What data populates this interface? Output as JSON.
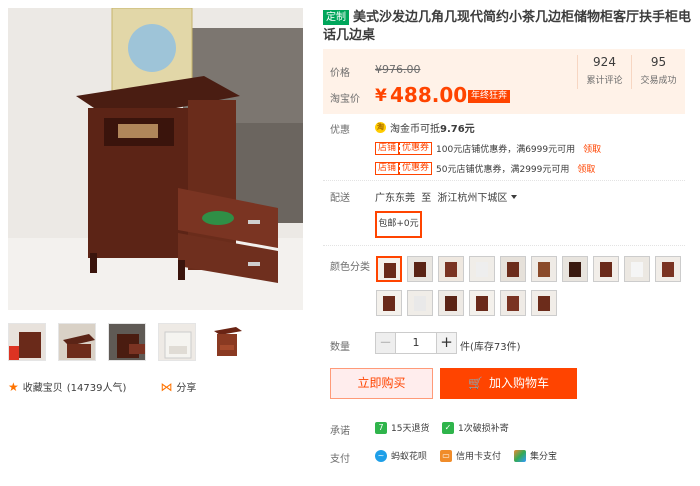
{
  "product": {
    "badge": "定制",
    "title": "美式沙发边几角几现代简约小茶几边柜储物柜客厅扶手柜电话几边桌"
  },
  "price": {
    "orig_label": "价格",
    "orig_price": "¥976.00",
    "taobao_label": "淘宝价",
    "currency": "¥",
    "price": "488.00",
    "promo": "年终狂奔",
    "stats": [
      {
        "num": "924",
        "label": "累计评论"
      },
      {
        "num": "95",
        "label": "交易成功"
      }
    ]
  },
  "promo": {
    "label": "优惠",
    "coin_text": "淘金币可抵",
    "coin_amount": "9.76元",
    "coupons": [
      {
        "tag1": "店铺",
        "tag2": "优惠券",
        "text": "100元店铺优惠券，满6999元可用",
        "link": "领取"
      },
      {
        "tag1": "店铺",
        "tag2": "优惠券",
        "text": "50元店铺优惠券，满2999元可用",
        "link": "领取"
      }
    ]
  },
  "shipping": {
    "label": "配送",
    "from": "广东东莞",
    "to_label": "至",
    "to": "浙江杭州下城区",
    "option": "包邮+0元"
  },
  "color": {
    "label": "颜色分类",
    "swatch_count_row1": 10,
    "swatch_count_row2": 6
  },
  "quantity": {
    "label": "数量",
    "minus": "−",
    "value": "1",
    "plus": "+",
    "stock": "件(库存73件)"
  },
  "actions": {
    "buy_now": "立即购买",
    "add_cart": "加入购物车"
  },
  "promise": {
    "label": "承诺",
    "items": [
      "15天退货",
      "1次破损补寄"
    ]
  },
  "payment": {
    "label": "支付",
    "items": [
      "蚂蚁花呗",
      "信用卡支付",
      "集分宝"
    ]
  },
  "social": {
    "favorite": "收藏宝贝",
    "popularity": "(14739人气)",
    "share": "分享"
  },
  "colors": {
    "accent": "#ff4400",
    "price_bg": "#fff2e8",
    "badge_green": "#00a65b"
  }
}
